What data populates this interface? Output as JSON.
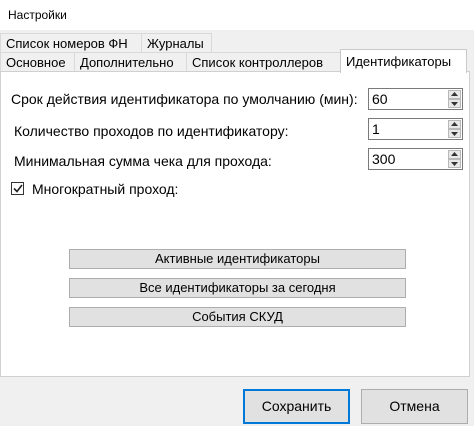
{
  "window": {
    "title": "Настройки"
  },
  "tabs_row1": [
    {
      "label": "Список номеров ФН"
    },
    {
      "label": "Журналы"
    }
  ],
  "tabs_row2": [
    {
      "label": "Основное"
    },
    {
      "label": "Дополнительно"
    },
    {
      "label": "Список контроллеров"
    },
    {
      "label": "Идентификаторы",
      "active": true
    }
  ],
  "fields": {
    "validity": {
      "label": "Срок действия идентификатора по умолчанию (мин):",
      "value": "60"
    },
    "passes": {
      "label": "Количество проходов по идентификатору:",
      "value": "1"
    },
    "min_sum": {
      "label": "Минимальная сумма чека для прохода:",
      "value": "300"
    }
  },
  "multi_pass": {
    "label": "Многократный проход:",
    "checked": true
  },
  "buttons": {
    "active_ids": "Активные идентификаторы",
    "all_today": "Все идентификаторы за сегодня",
    "skud_events": "События СКУД",
    "save": "Сохранить",
    "cancel": "Отмена"
  },
  "colors": {
    "focus_border": "#0078d7",
    "panel_bg": "#ffffff",
    "window_bg": "#f0f0f0"
  }
}
